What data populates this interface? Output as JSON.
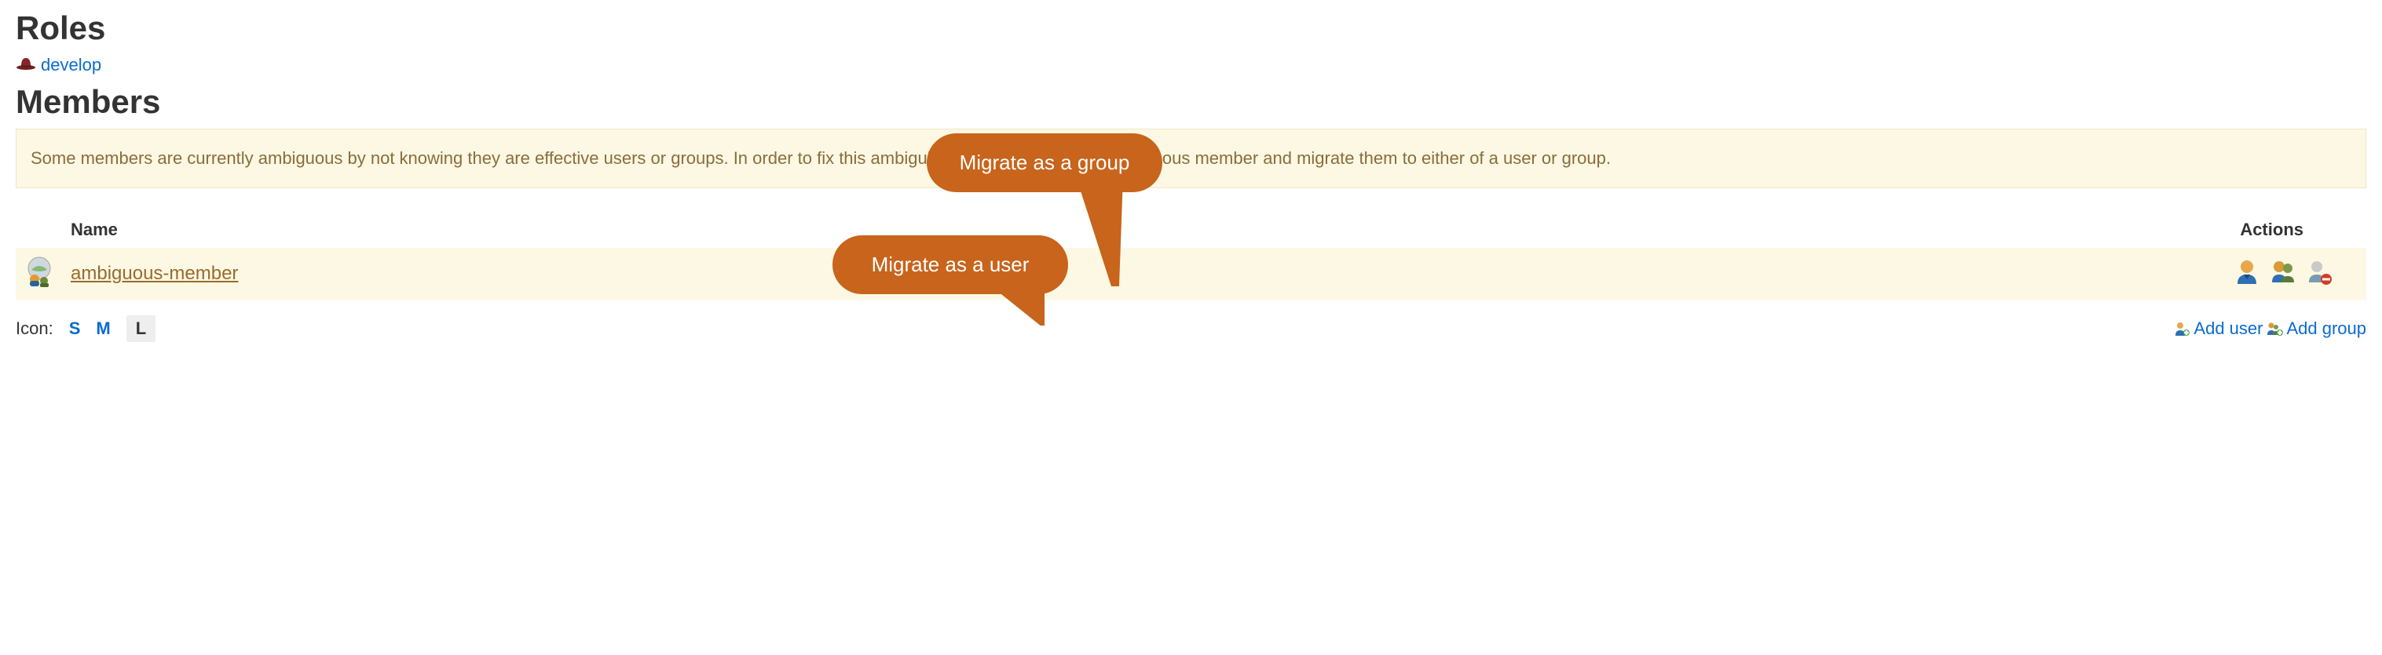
{
  "headings": {
    "roles": "Roles",
    "members": "Members"
  },
  "role": {
    "name": "develop"
  },
  "notice": "Some members are currently ambiguous by not knowing they are effective users or groups. In order to fix this ambiguity, please review each ambiguous member and migrate them to either of a user or group.",
  "callouts": {
    "user": "Migrate as a user",
    "group": "Migrate as a group"
  },
  "table": {
    "headers": {
      "name": "Name",
      "actions": "Actions"
    },
    "row": {
      "member": "ambiguous-member"
    }
  },
  "footer": {
    "icon_label": "Icon:",
    "sizes": {
      "s": "S",
      "m": "M",
      "l": "L"
    },
    "add_user": "Add user",
    "add_group": "Add group"
  }
}
